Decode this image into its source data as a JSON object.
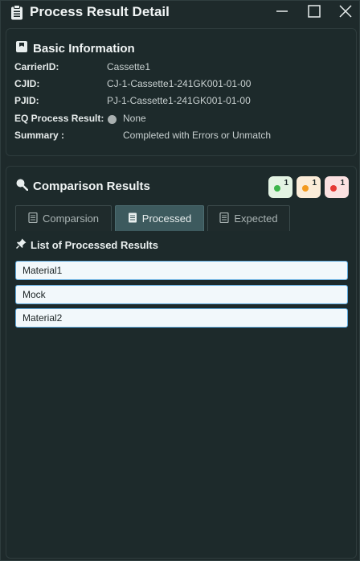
{
  "window": {
    "title": "Process Result Detail",
    "icons": {
      "app": "clipboard-icon",
      "minimize": "minimize-icon",
      "maximize": "maximize-icon",
      "close": "close-icon"
    }
  },
  "basic_info": {
    "title": "Basic Information",
    "icon": "info-box-icon",
    "rows": {
      "carrier_key": "CarrierID:",
      "carrier_val": "Cassette1",
      "cjid_key": "CJID:",
      "cjid_val": "CJ-1-Cassette1-241GK001-01-00",
      "pjid_key": "PJID:",
      "pjid_val": "PJ-1-Cassette1-241GK001-01-00",
      "eq_key": "EQ Process Result:",
      "eq_val": "None",
      "summary_key": "Summary :",
      "summary_val": "Completed with Errors or Unmatch"
    }
  },
  "comparison": {
    "title": "Comparison Results",
    "icon": "magnifier-icon",
    "badges": [
      {
        "status": "green",
        "count": "1",
        "bg": "#e3f3e3",
        "dot": "#3bb54a"
      },
      {
        "status": "orange",
        "count": "1",
        "bg": "#fbecd8",
        "dot": "#f39a1f"
      },
      {
        "status": "red",
        "count": "1",
        "bg": "#fbe1e1",
        "dot": "#e53935"
      }
    ],
    "tabs": {
      "comparison": "Comparsion",
      "processed": "Processed",
      "expected": "Expected"
    },
    "active_tab": "Processed",
    "list_title": "List of Processed Results",
    "list_icon": "pin-icon",
    "items": [
      "Material1",
      "Mock",
      "Material2"
    ]
  },
  "colors": {
    "background": "#1e2a2b",
    "active_tab": "#3d5a5e",
    "item_border": "#5ea9dc"
  }
}
